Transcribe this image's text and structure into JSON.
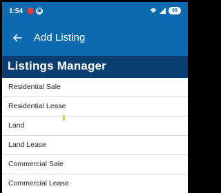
{
  "status_bar": {
    "time": "1:54",
    "notif_icon_1": "!",
    "notif_icon_2": "▣",
    "battery": "99",
    "icons": [
      "alert-notification-icon",
      "sim-icon",
      "wifi-icon",
      "signal-icon",
      "battery-icon"
    ]
  },
  "app_bar": {
    "back_icon": "arrow-left-icon",
    "title": "Add Listing"
  },
  "section": {
    "title": "Listings Manager"
  },
  "listing_types": [
    "Residential Sale",
    "Residential Lease",
    "Land",
    "Land Lease",
    "Commercial Sale",
    "Commercial Lease"
  ],
  "colors": {
    "app_bar": "#0b6ab0",
    "section_header": "#0a3f73",
    "divider": "#d8d8d8"
  }
}
